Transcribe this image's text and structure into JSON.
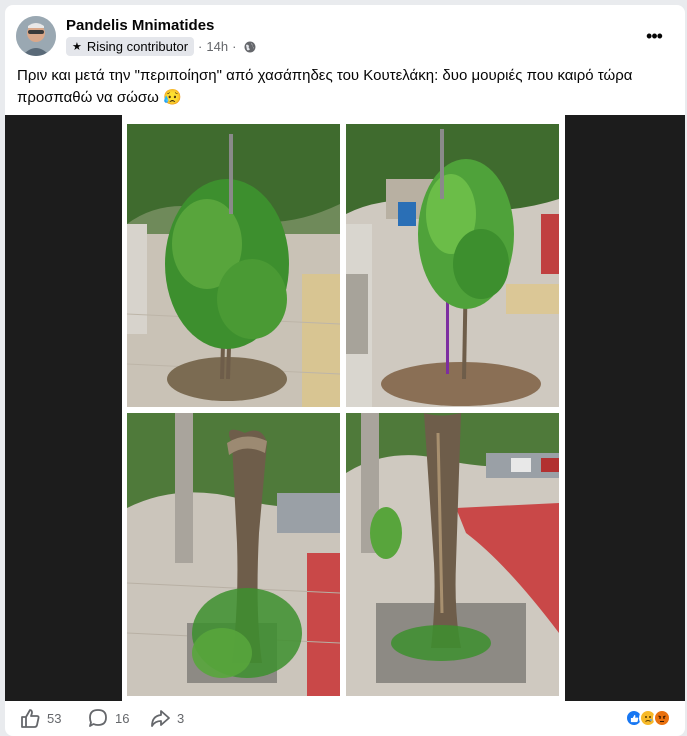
{
  "post": {
    "author": "Pandelis Mnimatides",
    "badge": "Rising contributor",
    "time": "14h",
    "separator": "·",
    "text": "Πριν και μετά την \"περιποίηση\" από χασάπηδες του Κουτελάκη: δυο μουριές που καιρό τώρα προσπαθώ να σώσω 😥",
    "more_label": "•••"
  },
  "photos": [
    {
      "name": "before-tree-1",
      "icon": "photo"
    },
    {
      "name": "before-tree-2",
      "icon": "photo"
    },
    {
      "name": "after-tree-1",
      "icon": "photo"
    },
    {
      "name": "after-tree-2",
      "icon": "photo"
    }
  ],
  "actions": {
    "like_count": "53",
    "comment_count": "16",
    "share_count": "3"
  },
  "reactions": [
    {
      "name": "like-reaction-icon",
      "color": "#1877f2"
    },
    {
      "name": "sad-reaction-icon",
      "color": "#f7b928"
    },
    {
      "name": "angry-reaction-icon",
      "color": "#e9710f"
    }
  ],
  "colors": {
    "accent": "#1877f2",
    "muted": "#65676b",
    "pavement": "#cfc9c0",
    "foliage": "#3d8f2e",
    "bark": "#6e5d4a"
  }
}
